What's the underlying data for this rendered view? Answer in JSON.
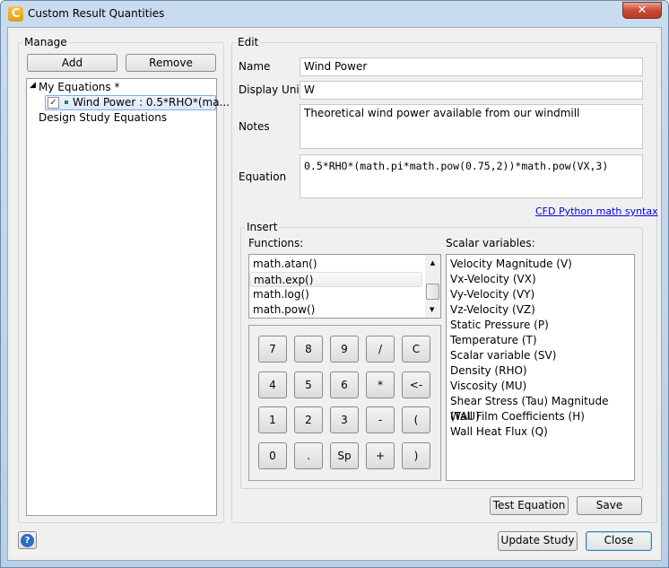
{
  "window": {
    "title": "Custom Result Quantities",
    "close_glyph": "✕",
    "app_icon_letter": "C"
  },
  "manage": {
    "label": "Manage",
    "add": "Add",
    "remove": "Remove",
    "tree": {
      "my_equations": "My Equations *",
      "item": "Wind Power : 0.5*RHO*(ma...",
      "item_checked": true,
      "design_study": "Design Study Equations"
    }
  },
  "edit": {
    "label": "Edit",
    "name_label": "Name",
    "name_value": "Wind Power",
    "units_label": "Display Units",
    "units_value": "W",
    "notes_label": "Notes",
    "notes_value": "Theoretical wind power available from our windmill",
    "equation_label": "Equation",
    "equation_value": "0.5*RHO*(math.pi*math.pow(0.75,2))*math.pow(VX,3)",
    "link": "CFD Python math syntax"
  },
  "insert": {
    "label": "Insert",
    "functions_label": "Functions:",
    "functions": [
      "math.atan()",
      "math.exp()",
      "math.log()",
      "math.pow()"
    ],
    "selected_function": "math.exp()",
    "keypad": [
      [
        "7",
        "8",
        "9",
        "/",
        "C"
      ],
      [
        "4",
        "5",
        "6",
        "*",
        "<-"
      ],
      [
        "1",
        "2",
        "3",
        "-",
        "("
      ],
      [
        "0",
        ".",
        "Sp",
        "+",
        ")"
      ]
    ],
    "scalars_label": "Scalar variables:",
    "scalars": [
      "Velocity Magnitude (V)",
      "Vx-Velocity (VX)",
      "Vy-Velocity (VY)",
      "Vz-Velocity (VZ)",
      "Static Pressure (P)",
      "Temperature (T)",
      "Scalar variable (SV)",
      "Density (RHO)",
      "Viscosity (MU)",
      "Shear Stress (Tau) Magnitude (TAU)",
      "Wall Film Coefficients (H)",
      "Wall Heat Flux (Q)"
    ]
  },
  "buttons": {
    "test": "Test Equation",
    "save": "Save",
    "update": "Update Study",
    "close": "Close",
    "help_glyph": "?"
  },
  "colors": {
    "link": "#0000ee",
    "accent": "#3c7fb1"
  }
}
